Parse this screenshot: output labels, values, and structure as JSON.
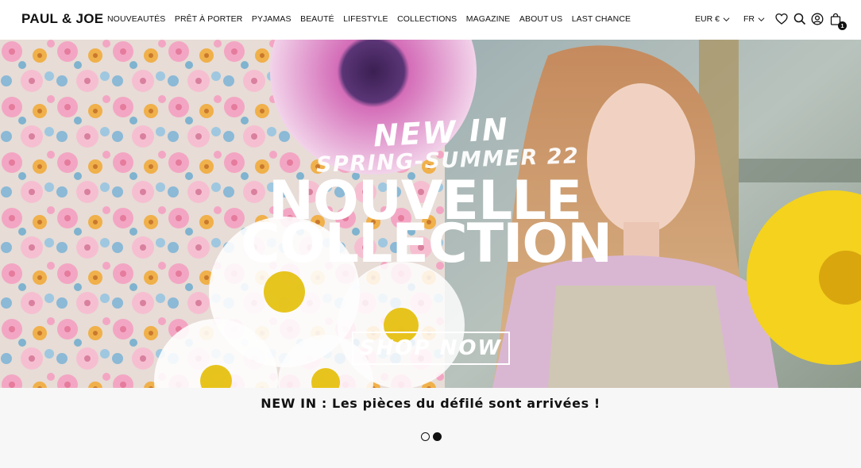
{
  "brand": {
    "logo_text": "PAUL & JOE"
  },
  "nav": {
    "items": [
      {
        "label": "NOUVEAUTÉS"
      },
      {
        "label": "PRÊT À PORTER"
      },
      {
        "label": "PYJAMAS"
      },
      {
        "label": "BEAUTÉ"
      },
      {
        "label": "LIFESTYLE"
      },
      {
        "label": "COLLECTIONS"
      },
      {
        "label": "MAGAZINE"
      },
      {
        "label": "ABOUT US"
      },
      {
        "label": "LAST CHANCE"
      }
    ]
  },
  "tools": {
    "currency": "EUR €",
    "language": "FR",
    "icons": [
      "heart-icon",
      "search-icon",
      "account-icon",
      "bag-icon"
    ],
    "cart_count": "1"
  },
  "hero": {
    "line1": "NEW IN",
    "line2": "SPRING-SUMMER 22",
    "line3": "NOUVELLE",
    "line4": "COLLECTION",
    "cta": "SHOP NOW"
  },
  "caption": "NEW IN : Les pièces du défilé sont arrivées !",
  "carousel": {
    "slides": 2,
    "active_slide": 2
  },
  "colors": {
    "header_bg": "#ffffff",
    "page_bg": "#f7f7f7",
    "text": "#111111"
  }
}
